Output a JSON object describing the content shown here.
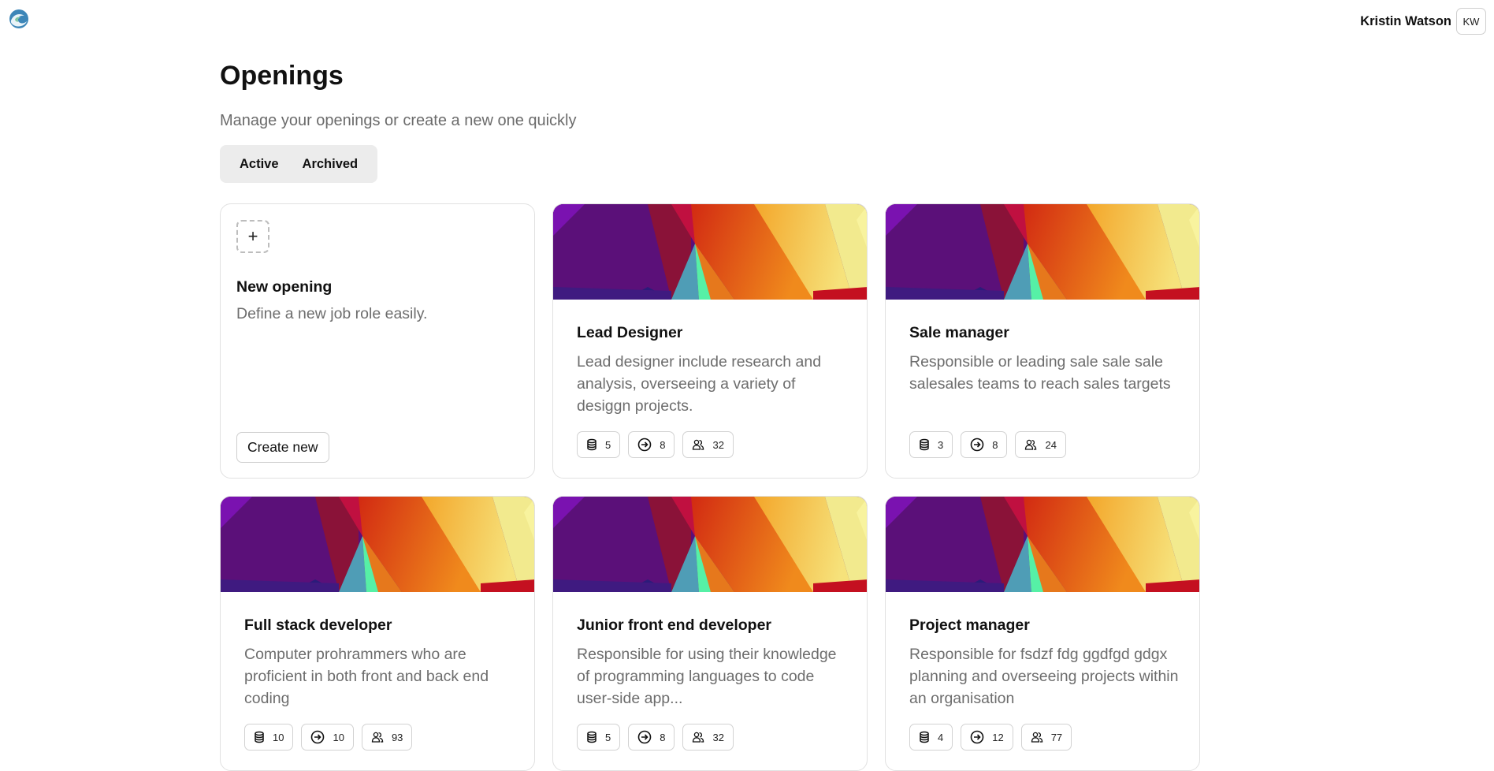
{
  "header": {
    "user_name": "Kristin Watson",
    "user_initials": "KW"
  },
  "page": {
    "title": "Openings",
    "subtitle": "Manage your openings or create a new one quickly",
    "tabs": [
      {
        "label": "Active"
      },
      {
        "label": "Archived"
      }
    ]
  },
  "new_card": {
    "plus": "+",
    "title": "New opening",
    "description": "Define a new job role easily.",
    "button_label": "Create new"
  },
  "openings": [
    {
      "title": "Lead Designer",
      "description": "Lead designer include research and analysis, overseeing a variety of desiggn projects.",
      "stats": [
        "5",
        "8",
        "32"
      ]
    },
    {
      "title": "Sale manager",
      "description": "Responsible or leading sale sale sale salesales teams to reach sales targets",
      "stats": [
        "3",
        "8",
        "24"
      ]
    },
    {
      "title": "Full stack developer",
      "description": "Computer prohrammers who are proficient in both front and back end coding",
      "stats": [
        "10",
        "10",
        "93"
      ]
    },
    {
      "title": "Junior front end developer",
      "description": "Responsible for using their knowledge of programming languages to code user-side app...",
      "stats": [
        "5",
        "8",
        "32"
      ]
    },
    {
      "title": "Project manager",
      "description": "Responsible for fsdzf fdg ggdfgd gdgx planning and overseeing projects within an organisation",
      "stats": [
        "4",
        "12",
        "77"
      ]
    }
  ],
  "stat_icons": [
    "database-icon",
    "arrow-circle-icon",
    "users-icon"
  ]
}
